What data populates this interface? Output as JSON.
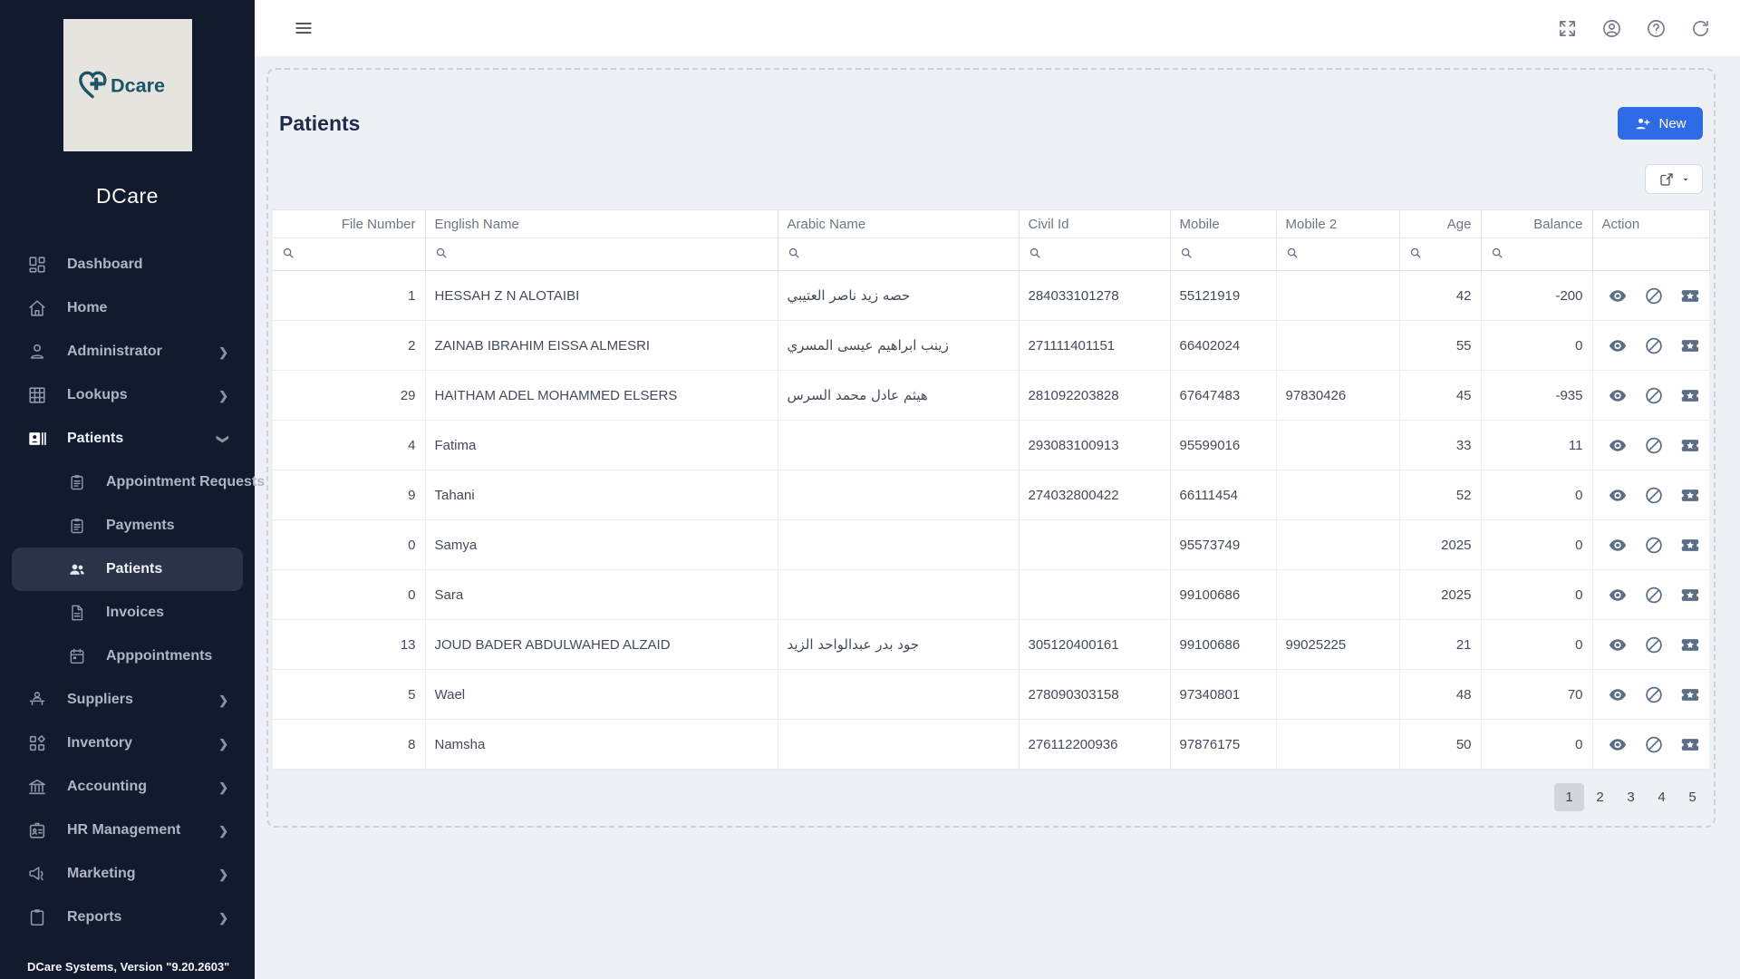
{
  "colors": {
    "sidebar_bg": "#121a2e",
    "accent_blue": "#2e6ce6",
    "page_bg": "#edf1f6",
    "active_item_bg": "#2b3348",
    "logo_teal": "#1b5468"
  },
  "sidebar": {
    "logo_text": "Dcare",
    "app_name": "DCare",
    "items": [
      {
        "icon": "dashboard",
        "label": "Dashboard"
      },
      {
        "icon": "home",
        "label": "Home"
      },
      {
        "icon": "person",
        "label": "Administrator",
        "expandable": true
      },
      {
        "icon": "lookup-grid",
        "label": "Lookups",
        "expandable": true
      },
      {
        "icon": "contact-card",
        "label": "Patients",
        "expandable": true,
        "expanded": true,
        "emph": true
      },
      {
        "icon": "clipboard-list",
        "label": "Appointment Requests",
        "child": true
      },
      {
        "icon": "clipboard-list",
        "label": "Payments",
        "child": true
      },
      {
        "icon": "people",
        "label": "Patients",
        "child": true,
        "active": true
      },
      {
        "icon": "document",
        "label": "Invoices",
        "child": true
      },
      {
        "icon": "calendar",
        "label": "Apppointments",
        "child": true
      },
      {
        "icon": "supplier",
        "label": "Suppliers",
        "expandable": true
      },
      {
        "icon": "inventory",
        "label": "Inventory",
        "expandable": true
      },
      {
        "icon": "bank",
        "label": "Accounting",
        "expandable": true
      },
      {
        "icon": "id-badge",
        "label": "HR Management",
        "expandable": true
      },
      {
        "icon": "megaphone",
        "label": "Marketing",
        "expandable": true
      },
      {
        "icon": "clipboard",
        "label": "Reports",
        "expandable": true
      }
    ],
    "footer": "DCare Systems, Version \"9.20.2603\""
  },
  "topbar": {
    "menu_icon": "menu",
    "icons": [
      {
        "icon": "fullscreen"
      },
      {
        "icon": "user"
      },
      {
        "icon": "help"
      },
      {
        "icon": "refresh"
      }
    ]
  },
  "page": {
    "title": "Patients",
    "new_button_label": "New"
  },
  "table": {
    "columns": [
      {
        "label": "File Number",
        "right": true
      },
      {
        "label": "English Name"
      },
      {
        "label": "Arabic Name"
      },
      {
        "label": "Civil Id"
      },
      {
        "label": "Mobile"
      },
      {
        "label": "Mobile 2"
      },
      {
        "label": "Age",
        "right": true
      },
      {
        "label": "Balance",
        "right": true
      },
      {
        "label": "Action",
        "no_filter": true
      }
    ],
    "action_icons": [
      "eye",
      "ban",
      "ticket-star"
    ],
    "rows": [
      {
        "file": "1",
        "english": "HESSAH Z N ALOTAIBI",
        "arabic": "حصه زيد ناصر العتيبي",
        "civil": "284033101278",
        "mobile": "55121919",
        "mobile2": "",
        "age": "42",
        "balance": "-200"
      },
      {
        "file": "2",
        "english": "ZAINAB IBRAHIM EISSA ALMESRI",
        "arabic": "زينب ابراهيم عيسى المسري",
        "civil": "271111401151",
        "mobile": "66402024",
        "mobile2": "",
        "age": "55",
        "balance": "0"
      },
      {
        "file": "29",
        "english": "HAITHAM ADEL MOHAMMED ELSERS",
        "arabic": "هيثم عادل محمد السرس",
        "civil": "281092203828",
        "mobile": "67647483",
        "mobile2": "97830426",
        "age": "45",
        "balance": "-935"
      },
      {
        "file": "4",
        "english": "Fatima",
        "arabic": "",
        "civil": "293083100913",
        "mobile": "95599016",
        "mobile2": "",
        "age": "33",
        "balance": "11"
      },
      {
        "file": "9",
        "english": "Tahani",
        "arabic": "",
        "civil": "274032800422",
        "mobile": "66111454",
        "mobile2": "",
        "age": "52",
        "balance": "0"
      },
      {
        "file": "0",
        "english": "Samya",
        "arabic": "",
        "civil": "",
        "mobile": "95573749",
        "mobile2": "",
        "age": "2025",
        "balance": "0"
      },
      {
        "file": "0",
        "english": "Sara",
        "arabic": "",
        "civil": "",
        "mobile": "99100686",
        "mobile2": "",
        "age": "2025",
        "balance": "0"
      },
      {
        "file": "13",
        "english": "JOUD BADER ABDULWAHED ALZAID",
        "arabic": "جود بدر عبدالواحد الزيد",
        "civil": "305120400161",
        "mobile": "99100686",
        "mobile2": "99025225",
        "age": "21",
        "balance": "0"
      },
      {
        "file": "5",
        "english": "Wael",
        "arabic": "",
        "civil": "278090303158",
        "mobile": "97340801",
        "mobile2": "",
        "age": "48",
        "balance": "70"
      },
      {
        "file": "8",
        "english": "Namsha",
        "arabic": "",
        "civil": "276112200936",
        "mobile": "97876175",
        "mobile2": "",
        "age": "50",
        "balance": "0"
      }
    ],
    "pagination": {
      "pages": [
        {
          "label": "1",
          "active": true
        },
        {
          "label": "2"
        },
        {
          "label": "3"
        },
        {
          "label": "4"
        },
        {
          "label": "5"
        }
      ]
    }
  }
}
